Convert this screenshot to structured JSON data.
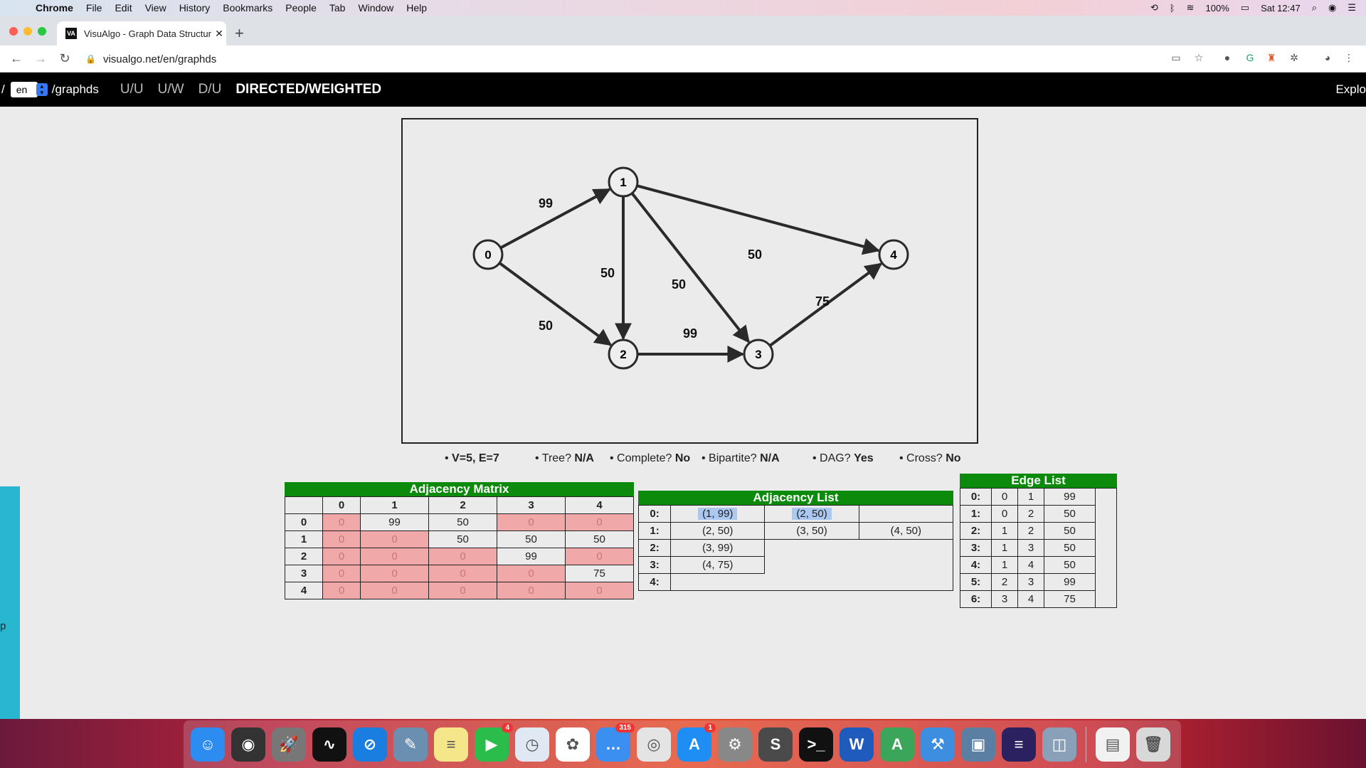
{
  "menubar": {
    "app": "Chrome",
    "items": [
      "File",
      "Edit",
      "View",
      "History",
      "Bookmarks",
      "People",
      "Tab",
      "Window",
      "Help"
    ],
    "battery": "100%",
    "clock": "Sat 12:47"
  },
  "browser": {
    "tab_title": "VisuAlgo - Graph Data Structur",
    "favicon_text": "VA",
    "url": "visualgo.net/en/graphds"
  },
  "visualgo": {
    "slash": "/",
    "lang": "en",
    "path": "/graphds",
    "modes": [
      "U/U",
      "U/W",
      "D/U",
      "DIRECTED/WEIGHTED"
    ],
    "explore": "Explo"
  },
  "graph": {
    "vertices": [
      {
        "id": "0"
      },
      {
        "id": "1"
      },
      {
        "id": "2"
      },
      {
        "id": "3"
      },
      {
        "id": "4"
      }
    ],
    "edges": [
      {
        "from": "0",
        "to": "1",
        "w": "99"
      },
      {
        "from": "0",
        "to": "2",
        "w": "50"
      },
      {
        "from": "1",
        "to": "2",
        "w": "50"
      },
      {
        "from": "1",
        "to": "3",
        "w": "50"
      },
      {
        "from": "1",
        "to": "4",
        "w": "50"
      },
      {
        "from": "2",
        "to": "3",
        "w": "99"
      },
      {
        "from": "3",
        "to": "4",
        "w": "75"
      }
    ]
  },
  "properties": {
    "ve": "V=5, E=7",
    "tree_label": "Tree?",
    "tree_val": "N/A",
    "complete_label": "Complete?",
    "complete_val": "No",
    "bipartite_label": "Bipartite?",
    "bipartite_val": "N/A",
    "dag_label": "DAG?",
    "dag_val": "Yes",
    "cross_label": "Cross?",
    "cross_val": "No"
  },
  "adjacency_matrix": {
    "title": "Adjacency Matrix",
    "cols": [
      "0",
      "1",
      "2",
      "3",
      "4"
    ],
    "rows": [
      {
        "label": "0",
        "cells": [
          "0",
          "99",
          "50",
          "0",
          "0"
        ]
      },
      {
        "label": "1",
        "cells": [
          "0",
          "0",
          "50",
          "50",
          "50"
        ]
      },
      {
        "label": "2",
        "cells": [
          "0",
          "0",
          "0",
          "99",
          "0"
        ]
      },
      {
        "label": "3",
        "cells": [
          "0",
          "0",
          "0",
          "0",
          "75"
        ]
      },
      {
        "label": "4",
        "cells": [
          "0",
          "0",
          "0",
          "0",
          "0"
        ]
      }
    ]
  },
  "adjacency_list": {
    "title": "Adjacency List",
    "rows": [
      {
        "label": "0:",
        "cells": [
          "(1, 99)",
          "(2, 50)"
        ]
      },
      {
        "label": "1:",
        "cells": [
          "(2, 50)",
          "(3, 50)",
          "(4, 50)"
        ]
      },
      {
        "label": "2:",
        "cells": [
          "(3, 99)"
        ]
      },
      {
        "label": "3:",
        "cells": [
          "(4, 75)"
        ]
      },
      {
        "label": "4:",
        "cells": []
      }
    ]
  },
  "edge_list": {
    "title": "Edge List",
    "rows": [
      {
        "label": "0:",
        "u": "0",
        "v": "1",
        "w": "99"
      },
      {
        "label": "1:",
        "u": "0",
        "v": "2",
        "w": "50"
      },
      {
        "label": "2:",
        "u": "1",
        "v": "2",
        "w": "50"
      },
      {
        "label": "3:",
        "u": "1",
        "v": "3",
        "w": "50"
      },
      {
        "label": "4:",
        "u": "1",
        "v": "4",
        "w": "50"
      },
      {
        "label": "5:",
        "u": "2",
        "v": "3",
        "w": "99"
      },
      {
        "label": "6:",
        "u": "3",
        "v": "4",
        "w": "75"
      }
    ]
  },
  "side_strip_text": "p",
  "dock": {
    "items": [
      {
        "name": "finder",
        "color": "#2d8cf0",
        "glyph": "☺"
      },
      {
        "name": "siri",
        "color": "#333",
        "glyph": "◉"
      },
      {
        "name": "launchpad",
        "color": "#777",
        "glyph": "🚀"
      },
      {
        "name": "activity-monitor",
        "color": "#111",
        "glyph": "∿"
      },
      {
        "name": "safari",
        "color": "#1a7de0",
        "glyph": "⊘"
      },
      {
        "name": "preview",
        "color": "#6a8fb0",
        "glyph": "✎"
      },
      {
        "name": "notes",
        "color": "#f6e68a",
        "glyph": "≡"
      },
      {
        "name": "facetime",
        "color": "#2bbd4c",
        "glyph": "▶",
        "badge": "4"
      },
      {
        "name": "calendar",
        "color": "#dfe8f3",
        "glyph": "◷"
      },
      {
        "name": "photos",
        "color": "#fff",
        "glyph": "✿"
      },
      {
        "name": "messages",
        "color": "#3b8ff0",
        "glyph": "…",
        "badge": "315"
      },
      {
        "name": "chrome",
        "color": "#e4e4e4",
        "glyph": "◎"
      },
      {
        "name": "app-store",
        "color": "#1e8ef5",
        "glyph": "A",
        "badge": "1"
      },
      {
        "name": "system-preferences",
        "color": "#888",
        "glyph": "⚙"
      },
      {
        "name": "sublime-text",
        "color": "#4a4a4a",
        "glyph": "S"
      },
      {
        "name": "terminal",
        "color": "#111",
        "glyph": ">_"
      },
      {
        "name": "word",
        "color": "#1f5bbd",
        "glyph": "W"
      },
      {
        "name": "android-studio",
        "color": "#3ba55a",
        "glyph": "A"
      },
      {
        "name": "xcode",
        "color": "#3d8ee0",
        "glyph": "⚒"
      },
      {
        "name": "image-viewer",
        "color": "#5b7fa3",
        "glyph": "▣"
      },
      {
        "name": "eclipse",
        "color": "#2c2160",
        "glyph": "≡"
      },
      {
        "name": "image-capture",
        "color": "#8aa0b8",
        "glyph": "◫"
      },
      {
        "name": "documents",
        "color": "#f1f1f1",
        "glyph": "▤"
      },
      {
        "name": "trash",
        "color": "#d8d8d8",
        "glyph": "🗑"
      }
    ]
  }
}
